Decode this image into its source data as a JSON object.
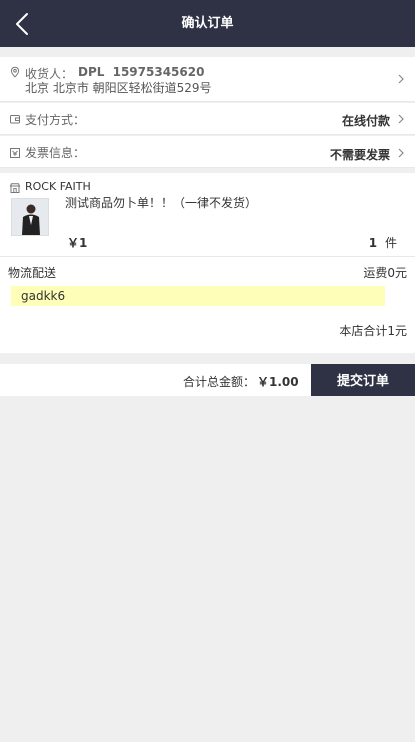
{
  "header": {
    "title": "确认订单"
  },
  "address": {
    "recipient_label": "收货人：",
    "recipient_name": "DPL",
    "phone": "15975345620",
    "address_line": "北京 北京市 朝阳区轻松街道529号"
  },
  "payment": {
    "label": "支付方式：",
    "value": "在线付款"
  },
  "invoice": {
    "label": "发票信息：",
    "value": "不需要发票"
  },
  "shop": {
    "name": "ROCK FAITH"
  },
  "product": {
    "name": "测试商品勿卜单！！（一律不发货）",
    "price": "￥1",
    "qty_number": "1",
    "qty_unit": "件"
  },
  "shipping": {
    "label": "物流配送",
    "fee": "运费0元"
  },
  "note": {
    "text": "gadkk6"
  },
  "store_total": {
    "text": "本店合计1元"
  },
  "footer": {
    "total_label": "合计总金额：",
    "total_value": "￥1.00",
    "submit_label": "提交订单"
  }
}
